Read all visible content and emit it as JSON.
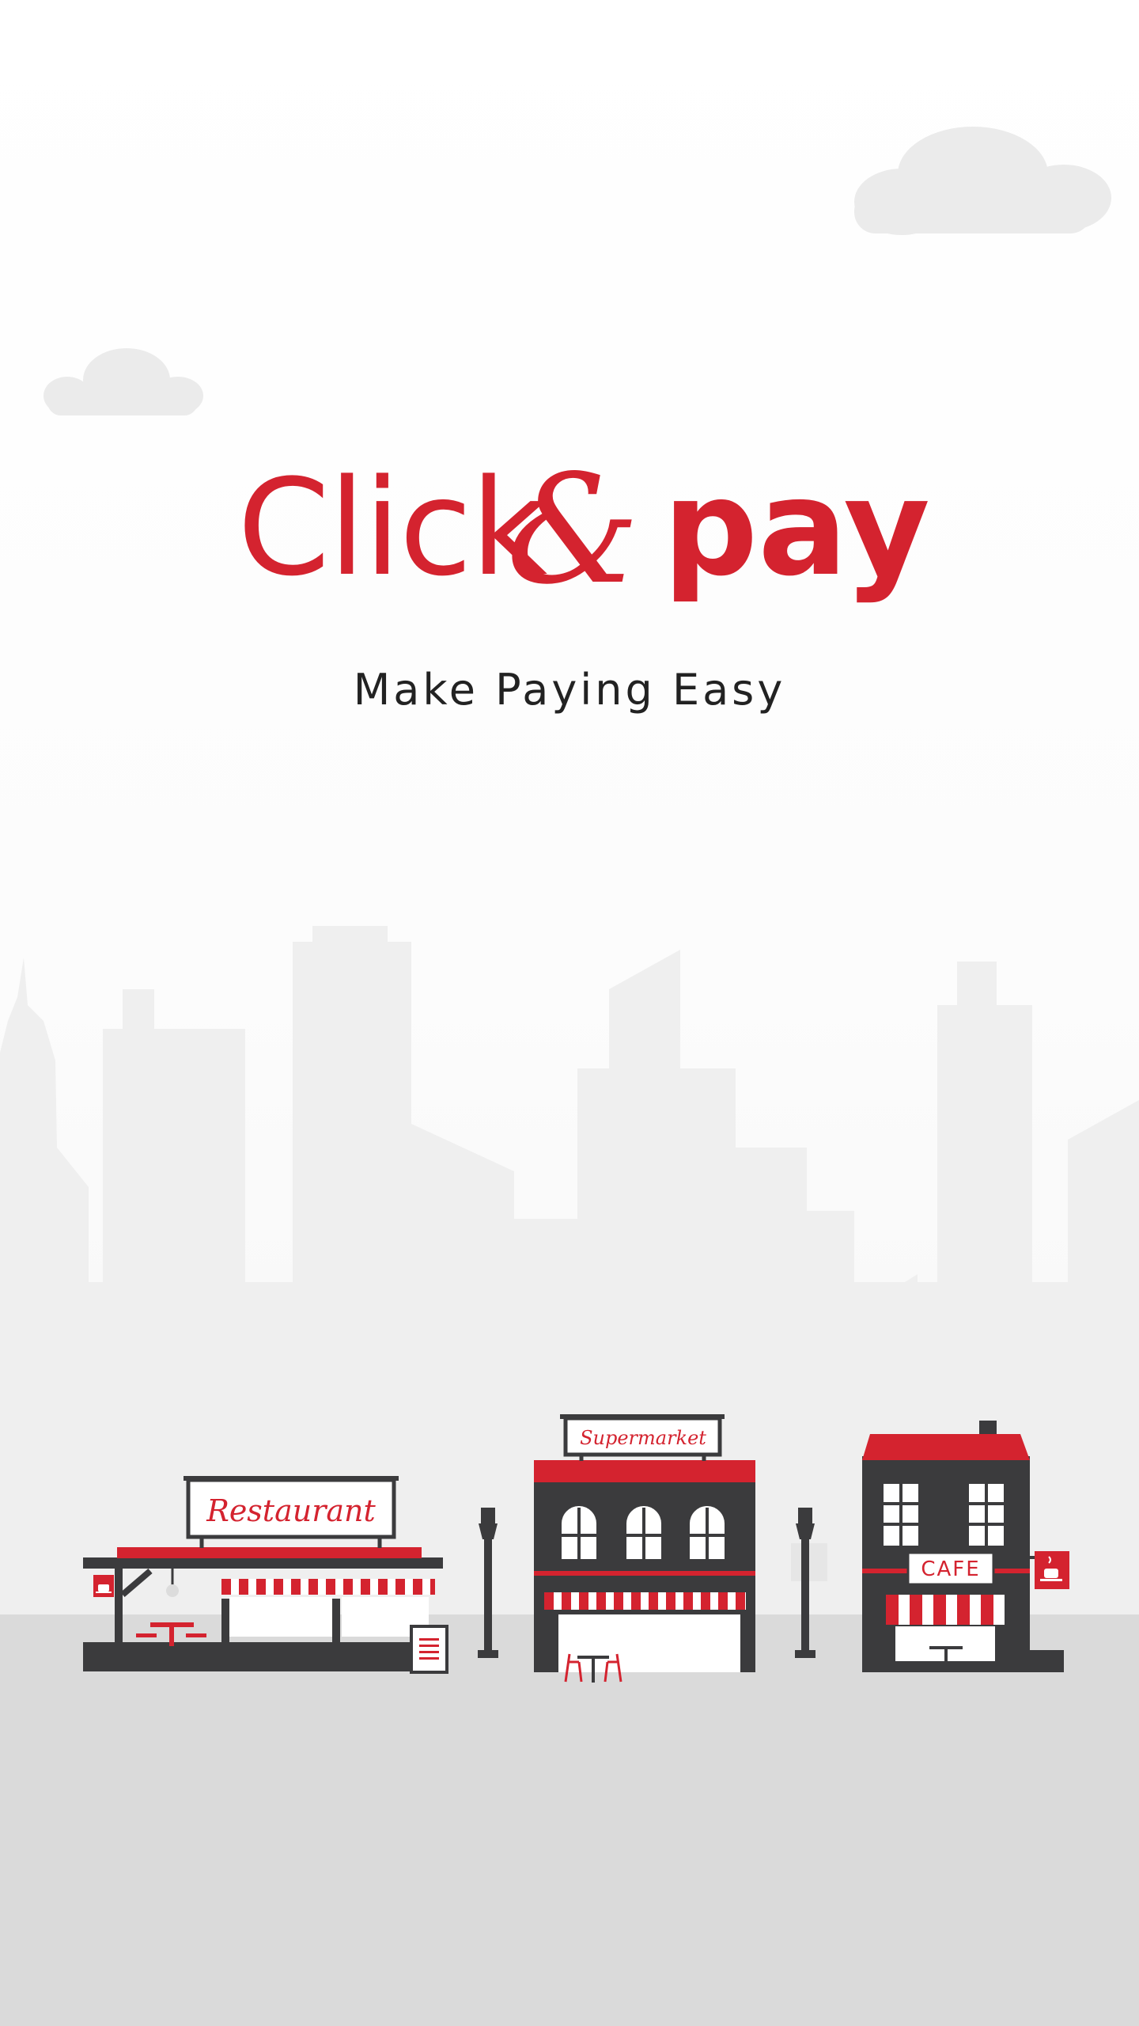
{
  "brand": {
    "name_left": "Click",
    "name_right": "pay",
    "ampersand": "&",
    "tagline": "Make Paying Easy"
  },
  "storefronts": {
    "restaurant_sign": "Restaurant",
    "supermarket_sign": "Supermarket",
    "cafe_sign": "CAFE"
  },
  "icons": {
    "cloud": "cloud-icon",
    "cup": "coffee-cup-icon",
    "lamp": "street-lamp-icon"
  },
  "colors": {
    "brand_red": "#d4232f",
    "building_dark": "#3b3b3d",
    "skyline": "#efefef",
    "ground": "#dadada",
    "cloud": "#ebebeb"
  }
}
